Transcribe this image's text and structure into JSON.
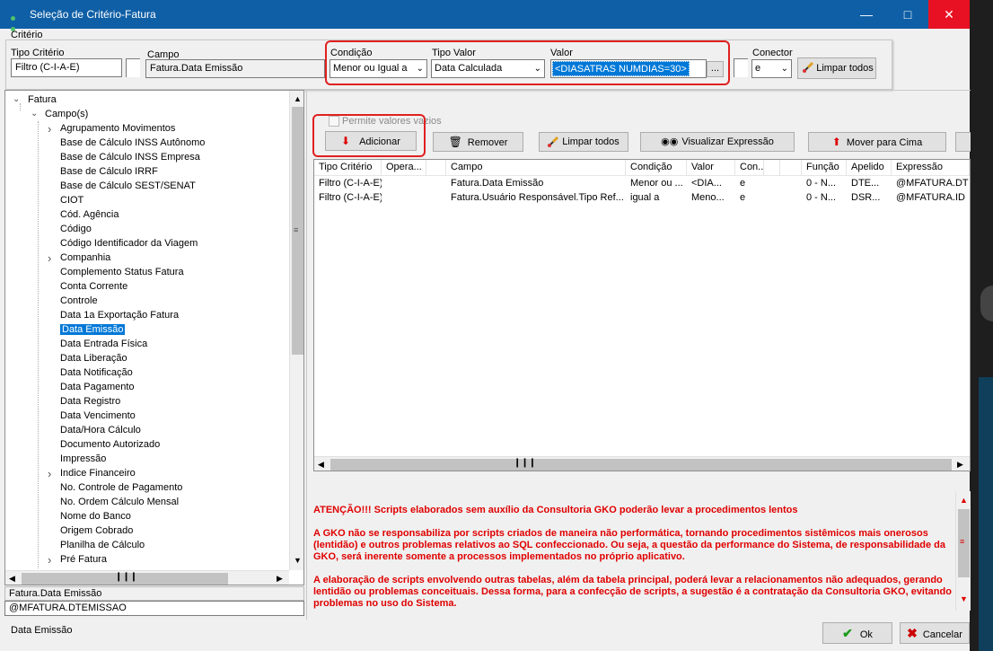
{
  "window": {
    "title": "Seleção de Critério-Fatura"
  },
  "menu": {
    "label": "Critério"
  },
  "criteria": {
    "tipo_criterio_label": "Tipo Critério",
    "tipo_criterio_value": "Filtro (C-I-A-E)",
    "campo_label": "Campo",
    "campo_value": "Fatura.Data Emissão",
    "condicao_label": "Condição",
    "condicao_value": "Menor ou Igual a",
    "tipo_valor_label": "Tipo Valor",
    "tipo_valor_value": "Data Calculada",
    "valor_label": "Valor",
    "valor_value": "<DIASATRAS NUMDIAS=30>",
    "valor_button": "...",
    "conector_label": "Conector",
    "conector_value": "e",
    "limpar_todos": "Limpar todos"
  },
  "tree": {
    "root": "Fatura",
    "campos": "Campo(s)",
    "items": [
      "Agrupamento Movimentos",
      "Base de Cálculo INSS Autônomo",
      "Base de Cálculo INSS Empresa",
      "Base de Cálculo IRRF",
      "Base de Cálculo SEST/SENAT",
      "CIOT",
      "Cód. Agência",
      "Código",
      "Código Identificador da Viagem",
      "Companhia",
      "Complemento Status Fatura",
      "Conta Corrente",
      "Controle",
      "Data 1a Exportação Fatura",
      "Data Emissão",
      "Data Entrada Física",
      "Data Liberação",
      "Data Notificação",
      "Data Pagamento",
      "Data Registro",
      "Data Vencimento",
      "Data/Hora Cálculo",
      "Documento Autorizado",
      "Impressão",
      "Indice Financeiro",
      "No. Controle de Pagamento",
      "No. Ordem Cálculo Mensal",
      "Nome do Banco",
      "Origem Cobrado",
      "Planilha de Cálculo",
      "Pré Fatura"
    ],
    "expandable": [
      "Agrupamento Movimentos",
      "Companhia",
      "Indice Financeiro",
      "Pré Fatura"
    ],
    "selected": "Data Emissão"
  },
  "selected_info": {
    "campo": "Fatura.Data Emissão",
    "expressao": "@MFATURA.DTEMISSAO",
    "descricao": "Data Emissão"
  },
  "actions": {
    "permite_vazios": "Permite valores vazios",
    "adicionar": "Adicionar",
    "remover": "Remover",
    "limpar_todos": "Limpar todos",
    "visualizar": "Visualizar Expressão",
    "mover_cima": "Mover para Cima"
  },
  "grid": {
    "columns": [
      "Tipo Critério",
      "Opera...",
      "",
      "Campo",
      "Condição",
      "Valor",
      "Con...",
      "",
      "",
      "Função",
      "Apelido",
      "Expressão"
    ],
    "rows": [
      [
        "Filtro (C-I-A-E)",
        "",
        "",
        "Fatura.Data Emissão",
        "Menor ou ...",
        "<DIA...",
        "e",
        "",
        "",
        "0 - N...",
        "DTE...",
        "@MFATURA.DT"
      ],
      [
        "Filtro (C-I-A-E)",
        "",
        "",
        "Fatura.Usuário Responsável.Tipo Ref...",
        "igual a",
        "Meno...",
        "e",
        "",
        "",
        "0 - N...",
        "DSR...",
        "@MFATURA.ID"
      ]
    ]
  },
  "warning": {
    "p1": "ATENÇÃO!!! Scripts elaborados sem auxílio da Consultoria GKO poderão levar a procedimentos lentos",
    "p2": "A GKO não se responsabiliza por scripts criados de maneira não performática, tornando procedimentos sistêmicos mais onerosos (lentidão) e outros problemas relativos ao SQL confeccionado. Ou seja, a questão da performance do Sistema, de responsabilidade da GKO, será inerente somente a processos implementados no próprio aplicativo.",
    "p3": "A elaboração de scripts envolvendo outras tabelas, além da tabela principal, poderá levar a relacionamentos não adequados, gerando lentidão ou problemas conceituais. Dessa forma, para a confecção de scripts, a sugestão é a contratação da Consultoria GKO, evitando problemas no uso do Sistema."
  },
  "footer": {
    "ok": "Ok",
    "cancelar": "Cancelar"
  }
}
